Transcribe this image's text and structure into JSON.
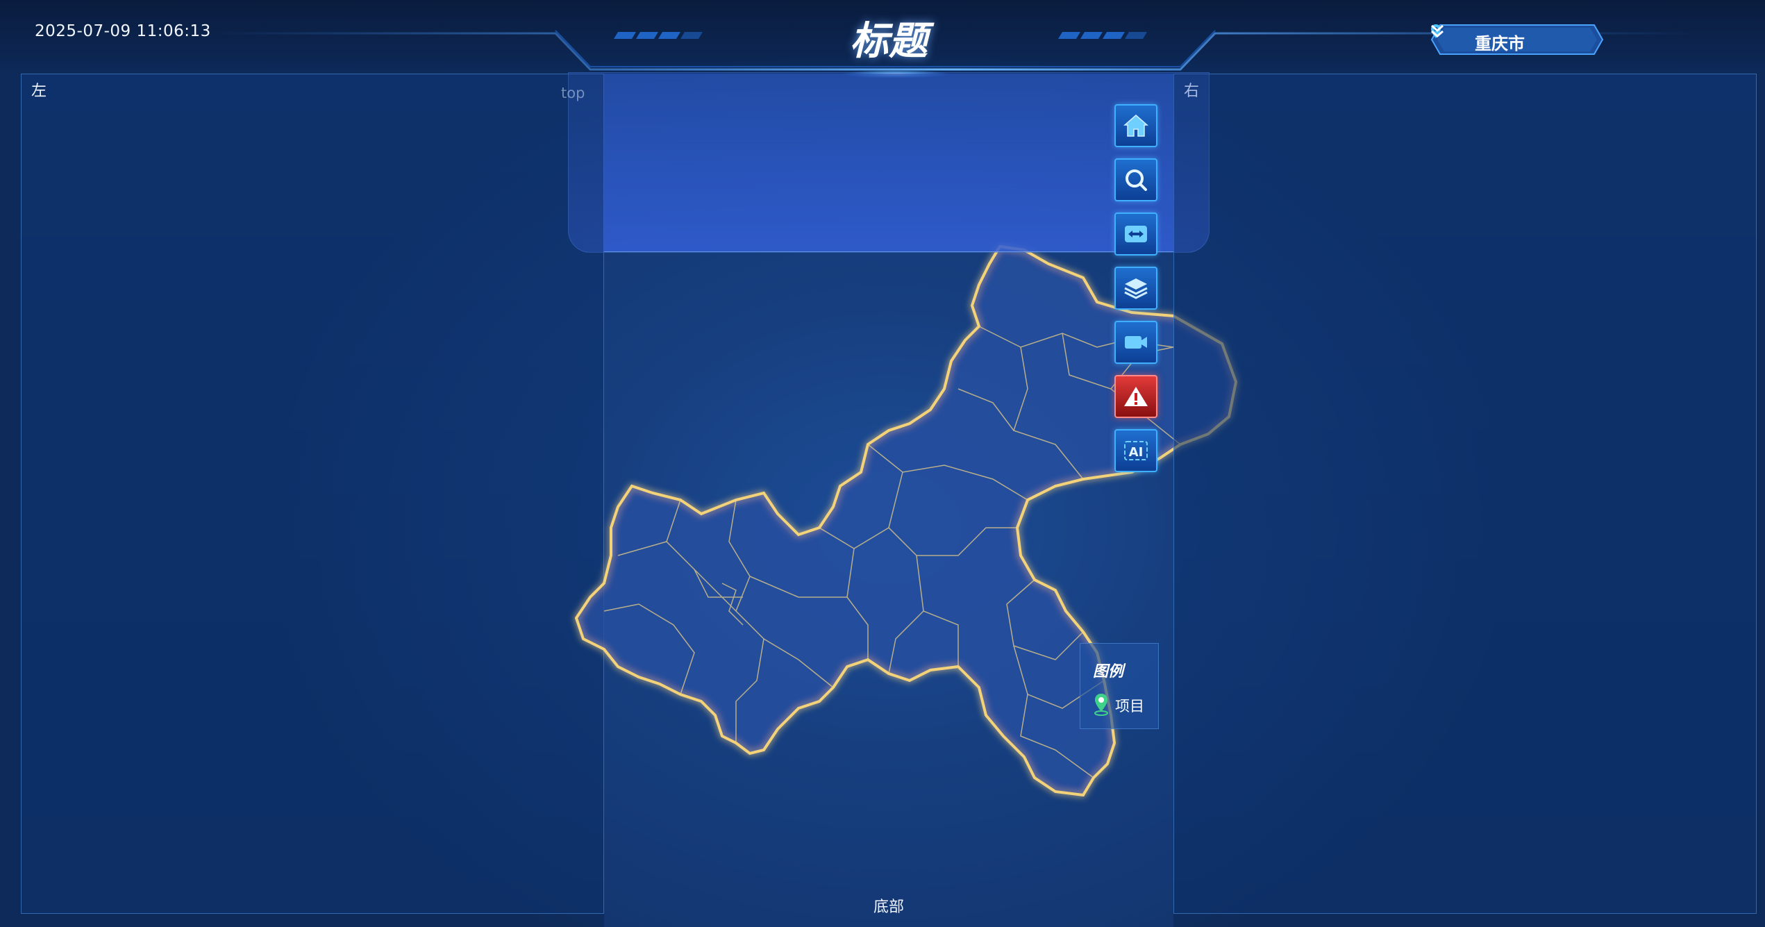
{
  "header": {
    "datetime": "2025-07-09 11:06:13",
    "title": "标题",
    "city_select": {
      "value": "重庆市",
      "icon": "location-pin-icon",
      "chevron": "chevron-down-icon"
    }
  },
  "panels": {
    "left_label": "左",
    "right_label": "右",
    "top_label": "top",
    "bottom_label": "底部"
  },
  "toolbar": [
    {
      "name": "home-button",
      "icon": "home-icon"
    },
    {
      "name": "search-button",
      "icon": "search-icon"
    },
    {
      "name": "compare-button",
      "icon": "split-compare-icon"
    },
    {
      "name": "layers-button",
      "icon": "layers-icon"
    },
    {
      "name": "video-button",
      "icon": "video-camera-icon"
    },
    {
      "name": "alert-button",
      "icon": "warning-icon",
      "color": "#e23a3a"
    },
    {
      "name": "ai-button",
      "icon": "ai-icon",
      "text": "AI"
    }
  ],
  "legend": {
    "title": "图例",
    "items": [
      {
        "label": "项目",
        "icon": "map-marker-icon",
        "color": "#3fd18a"
      }
    ]
  },
  "map": {
    "region": "重庆市",
    "border_color": "#f3d27a"
  },
  "colors": {
    "accent": "#3fb0ff",
    "background": "#0d2a5a",
    "alert": "#e23a3a"
  }
}
